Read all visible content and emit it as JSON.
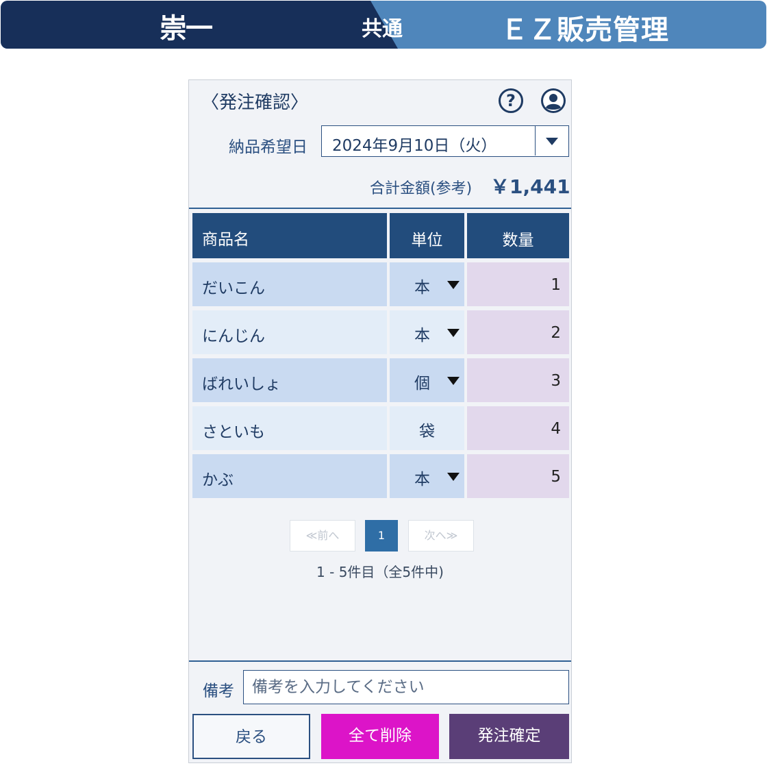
{
  "banner": {
    "brand": "崇一",
    "common": "共通",
    "product": "ＥＺ販売管理",
    "colors": {
      "dark": "#172f59",
      "light": "#4f86bb"
    }
  },
  "panel": {
    "title": "〈発注確認〉",
    "icons": [
      "help-icon",
      "user-icon"
    ]
  },
  "delivery": {
    "label": "納品希望日",
    "selected": "2024年9月10日（火）"
  },
  "total": {
    "label": "合計金額(参考)",
    "value": "￥1,441"
  },
  "table": {
    "headers": {
      "name": "商品名",
      "unit": "単位",
      "qty": "数量"
    },
    "rows": [
      {
        "name": "だいこん",
        "unit": "本",
        "qty": "1",
        "unit_dropdown": true
      },
      {
        "name": "にんじん",
        "unit": "本",
        "qty": "2",
        "unit_dropdown": true
      },
      {
        "name": "ばれいしょ",
        "unit": "個",
        "qty": "3",
        "unit_dropdown": true
      },
      {
        "name": "さといも",
        "unit": "袋",
        "qty": "4",
        "unit_dropdown": false
      },
      {
        "name": "かぶ",
        "unit": "本",
        "qty": "5",
        "unit_dropdown": true
      }
    ]
  },
  "pagination": {
    "prev": "≪前へ",
    "current": "1",
    "next": "次へ≫",
    "info": "1 - 5件目（全5件中)"
  },
  "remarks": {
    "label": "備考",
    "placeholder": "備考を入力してください",
    "value": ""
  },
  "buttons": {
    "back": "戻る",
    "clear_all": "全て削除",
    "confirm": "発注確定"
  },
  "colors": {
    "accent": "#224c7c",
    "clear": "#dc14c8",
    "confirm": "#5a3e77"
  }
}
